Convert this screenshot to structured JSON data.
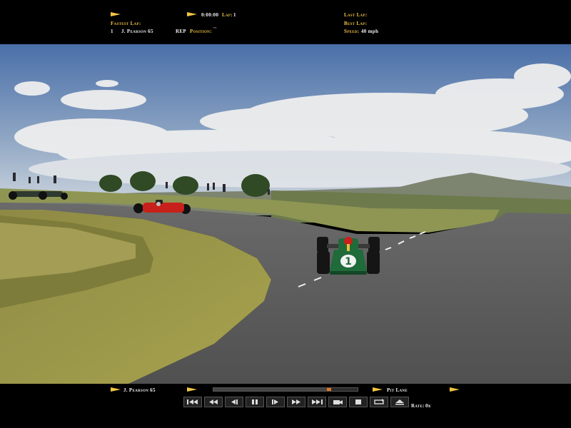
{
  "hud": {
    "fastest_lap_label": "Fastest Lap:",
    "race_time": "0:00:00",
    "lap_label": "Lap:",
    "lap_value": "1",
    "last_lap_label": "Last Lap:",
    "best_lap_label": "Best Lap:",
    "speed_label": "Speed:",
    "speed_value": "40 mph",
    "driver_position": "1",
    "driver_name": "J. Pearson 65",
    "rep_label": "REP",
    "position_label": "Position:",
    "position_value": "''"
  },
  "replay": {
    "driver_name": "J. Pearson 65",
    "pit_lane_label": "Pit Lane",
    "rate_label": "Rate:",
    "rate_value": "0x",
    "progress": 0.8,
    "controls": [
      {
        "name": "rewind-to-start-button",
        "icon": "skip-start-icon"
      },
      {
        "name": "fast-rewind-button",
        "icon": "fast-rewind-icon"
      },
      {
        "name": "step-back-button",
        "icon": "step-back-icon"
      },
      {
        "name": "pause-button",
        "icon": "pause-icon"
      },
      {
        "name": "play-button",
        "icon": "play-icon"
      },
      {
        "name": "fast-forward-button",
        "icon": "fast-forward-icon"
      },
      {
        "name": "skip-end-button",
        "icon": "skip-end-icon"
      },
      {
        "name": "camera-button",
        "icon": "camera-icon"
      },
      {
        "name": "stop-button",
        "icon": "stop-icon"
      },
      {
        "name": "loop-button",
        "icon": "loop-icon"
      },
      {
        "name": "eject-button",
        "icon": "eject-icon"
      }
    ]
  },
  "colors": {
    "hud_yellow": "#f2c542",
    "sky_top": "#4a6fa8",
    "grass": "#9a9a3c",
    "track": "#5a5a5a",
    "car_green": "#1f6b3a",
    "car_red": "#c8201a"
  }
}
